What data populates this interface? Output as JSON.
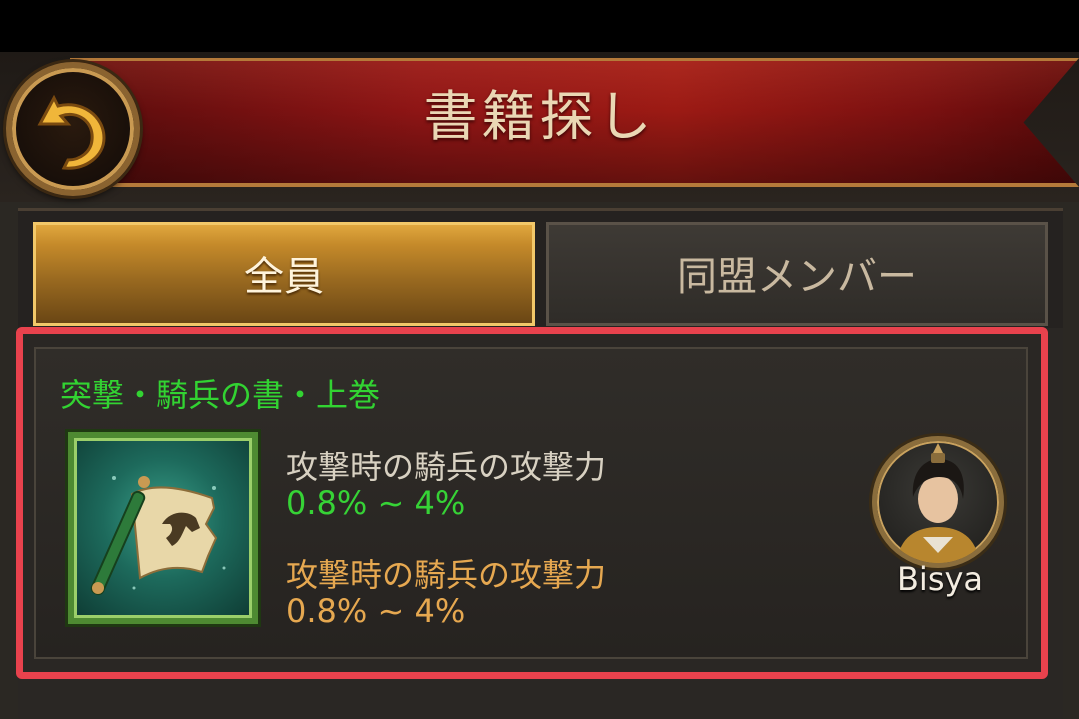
{
  "header": {
    "title": "書籍探し",
    "back_icon": "back-arrow-icon"
  },
  "tabs": [
    {
      "label": "全員",
      "selected": true
    },
    {
      "label": "同盟メンバー",
      "selected": false
    }
  ],
  "book": {
    "title": "突撃・騎兵の書・上巻",
    "icon": "scroll-horse-icon",
    "stats": [
      {
        "label": "攻撃時の騎兵の攻撃力",
        "value": "0.8% ~ 4%"
      },
      {
        "label": "攻撃時の騎兵の攻撃力",
        "value": "0.8% ~ 4%"
      }
    ],
    "player": {
      "name": "Bisya",
      "avatar_icon": "player-avatar-icon"
    }
  },
  "colors": {
    "title_green": "#32d332",
    "value_green": "#36d336",
    "orange": "#e6a850",
    "highlight_red": "#e8424d",
    "banner_red": "#8f1515",
    "tab_gold": "#c58a2a"
  }
}
